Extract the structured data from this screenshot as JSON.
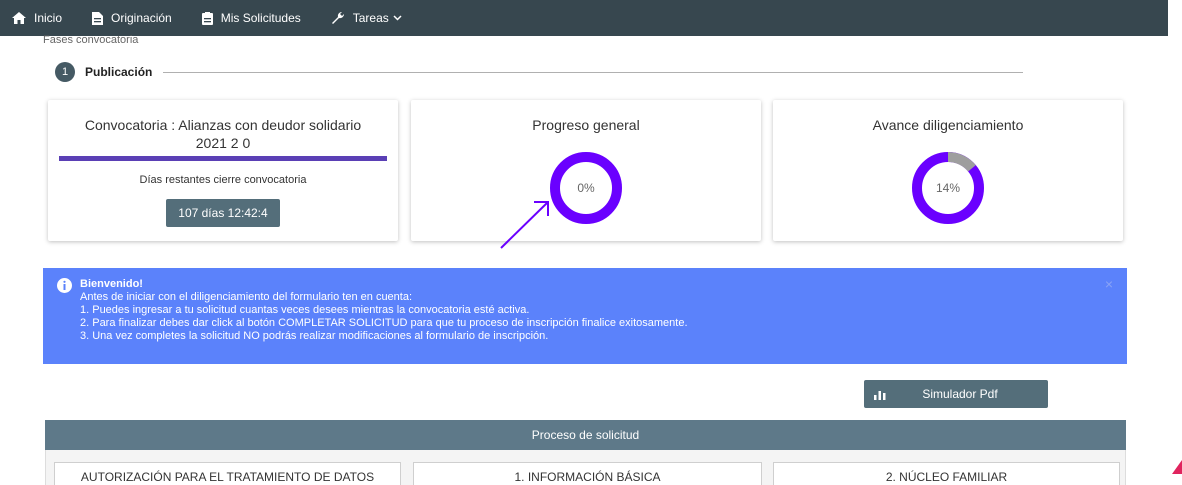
{
  "nav": {
    "items": [
      {
        "label": "Inicio",
        "icon": "home-icon"
      },
      {
        "label": "Originación",
        "icon": "document-icon"
      },
      {
        "label": "Mis Solicitudes",
        "icon": "clipboard-icon"
      },
      {
        "label": "Tareas",
        "icon": "wrench-icon"
      }
    ]
  },
  "breadcrumb": "Fases convocatoria",
  "stepper": {
    "number": "1",
    "label": "Publicación"
  },
  "cards": {
    "convocatoria": {
      "title": "Convocatoria : Alianzas con deudor solidario 2021 2 0",
      "days_label": "Días restantes cierre convocatoria",
      "countdown": "107 días 12:42:4"
    },
    "progreso": {
      "title": "Progreso general",
      "value_label": "0%",
      "value": 0
    },
    "avance": {
      "title": "Avance diligenciamiento",
      "value_label": "14%",
      "value": 0.14
    }
  },
  "alert": {
    "title": "Bienvenido!",
    "intro": "Antes de iniciar con el diligenciamiento del formulario ten en cuenta:",
    "lines": [
      "1. Puedes ingresar a tu solicitud cuantas veces desees mientras la convocatoria esté activa.",
      "2. Para finalizar debes dar click al botón COMPLETAR SOLICITUD para que tu proceso de inscripción finalice exitosamente.",
      "3. Una vez completes la solicitud NO podrás realizar modificaciones al formulario de inscripción."
    ],
    "close": "×"
  },
  "simulator_button": "Simulador Pdf",
  "process": {
    "header": "Proceso de solicitud",
    "tabs": [
      "AUTORIZACIÓN PARA EL TRATAMIENTO DE DATOS",
      "1. INFORMACIÓN BÁSICA",
      "2. NÚCLEO FAMILIAR"
    ]
  },
  "colors": {
    "nav_bg": "#37474f",
    "accent_purple": "#6a00ff",
    "alert_bg": "#5b82fb",
    "process_header": "#5e7989",
    "donut_remaining": "#9e9e9e"
  }
}
